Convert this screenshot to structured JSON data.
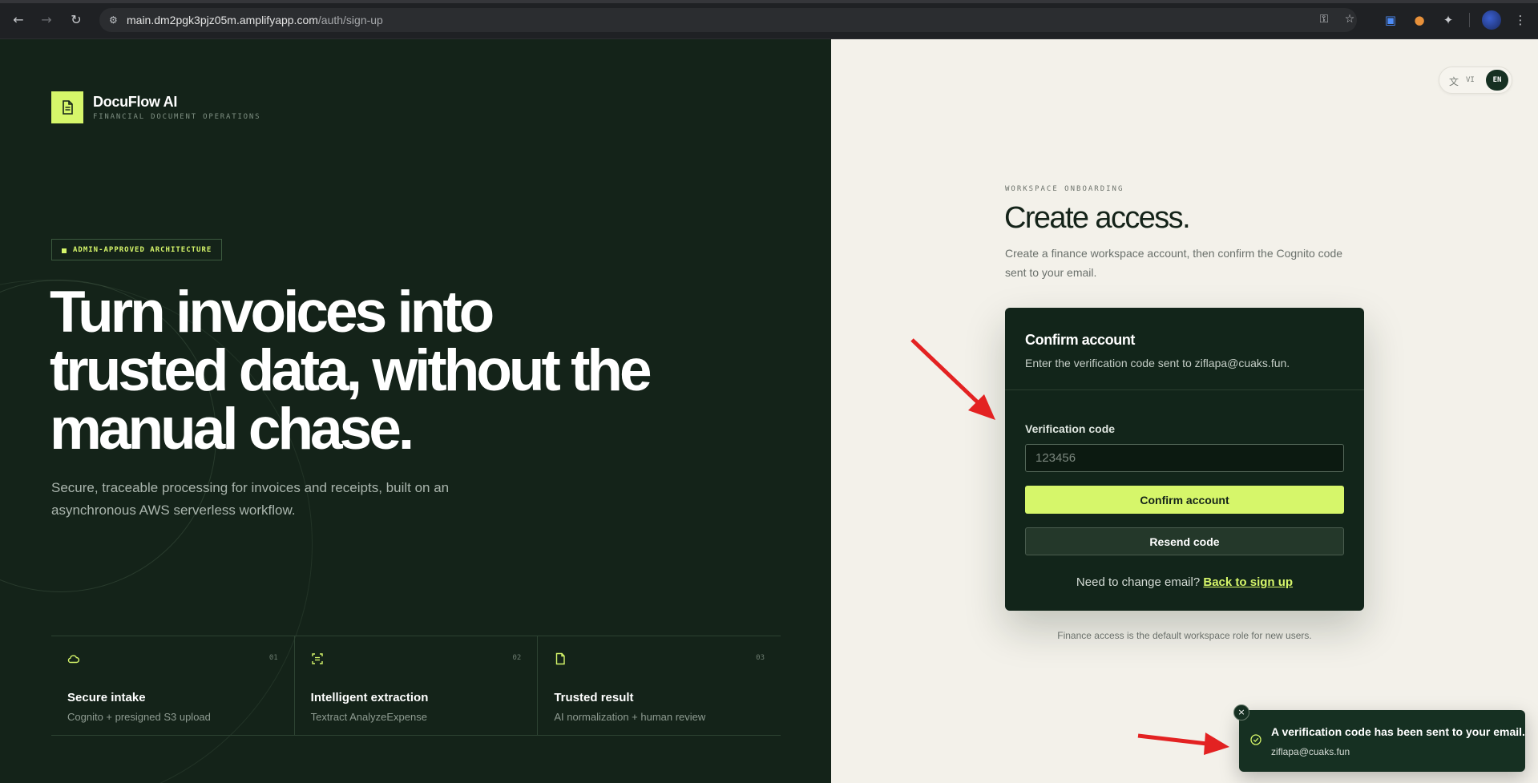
{
  "browser": {
    "url_host": "main.dm2pgk3pjz05m.amplifyapp.com",
    "url_path": "/auth/sign-up"
  },
  "brand": {
    "name": "DocuFlow AI",
    "tagline": "FINANCIAL DOCUMENT OPERATIONS"
  },
  "hero": {
    "badge": "ADMIN-APPROVED ARCHITECTURE",
    "title": "Turn invoices into trusted data, without the manual chase.",
    "subtitle": "Secure, traceable processing for invoices and receipts, built on an asynchronous AWS serverless workflow."
  },
  "features": [
    {
      "num": "01",
      "title": "Secure intake",
      "desc": "Cognito + presigned S3 upload",
      "icon": "cloud-icon"
    },
    {
      "num": "02",
      "title": "Intelligent extraction",
      "desc": "Textract AnalyzeExpense",
      "icon": "scan-icon"
    },
    {
      "num": "03",
      "title": "Trusted result",
      "desc": "AI normalization + human review",
      "icon": "document-icon"
    }
  ],
  "lang": {
    "vi": "VI",
    "en": "EN"
  },
  "onboarding": {
    "eyebrow": "WORKSPACE ONBOARDING",
    "title": "Create access.",
    "subtitle": "Create a finance workspace account, then confirm the Cognito code sent to your email."
  },
  "card": {
    "title": "Confirm account",
    "subtitle": "Enter the verification code sent to ziflapa@cuaks.fun.",
    "field_label": "Verification code",
    "code_placeholder": "123456",
    "confirm_label": "Confirm account",
    "resend_label": "Resend code",
    "footer_text": "Need to change email?",
    "footer_link": "Back to sign up"
  },
  "note": "Finance access is the default workspace role for new users.",
  "toast": {
    "title": "A verification code has been sent to your email.",
    "desc": "ziflapa@cuaks.fun"
  },
  "colors": {
    "accent": "#d6f66a",
    "dark": "#142319",
    "card": "#12251a",
    "annotation": "#e32222"
  }
}
